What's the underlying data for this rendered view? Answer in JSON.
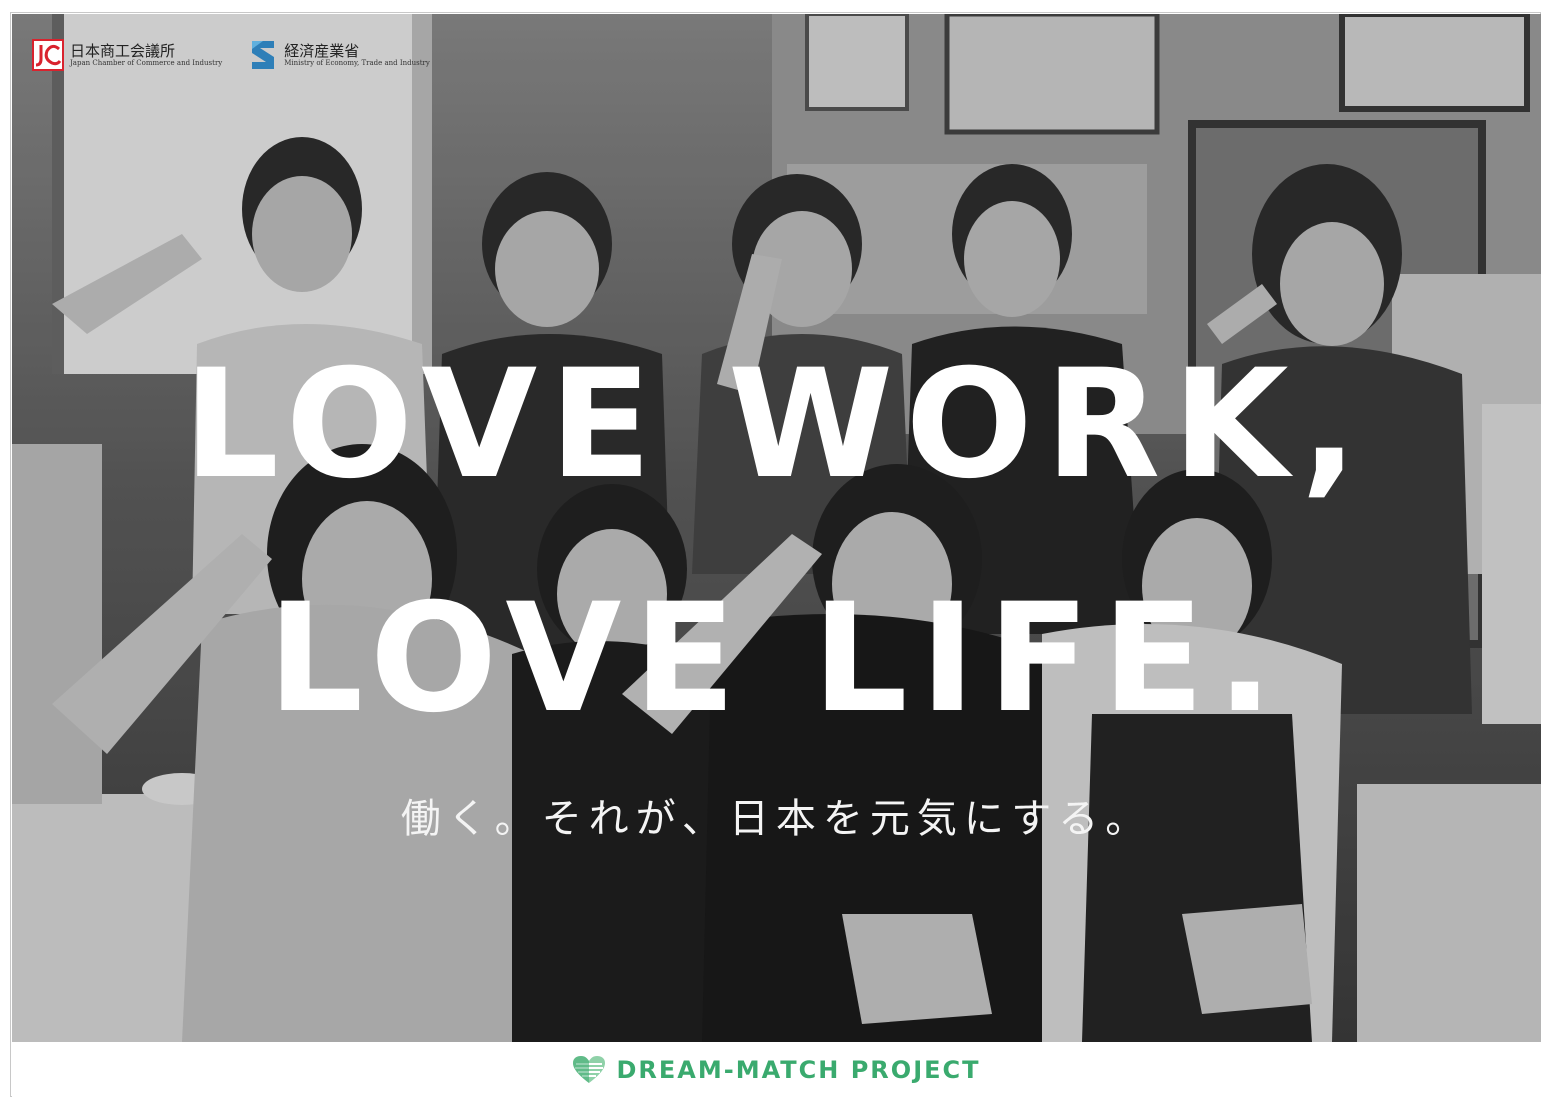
{
  "logos": {
    "jcci": {
      "name_ja": "日本商工会議所",
      "name_en": "Japan Chamber of Commerce and Industry"
    },
    "meti": {
      "name_ja": "経済産業省",
      "name_en": "Ministry of Economy, Trade and Industry"
    }
  },
  "headline": {
    "line1": "LOVE WORK,",
    "line2": "LOVE LIFE."
  },
  "tagline": "働く。それが、日本を元気にする。",
  "footer": {
    "brand": "DREAM-MATCH PROJECT",
    "brand_color": "#3aaa6e"
  },
  "colors": {
    "jcci_red": "#d9232e",
    "meti_blue": "#2e7fb8",
    "headline": "#ffffff"
  }
}
